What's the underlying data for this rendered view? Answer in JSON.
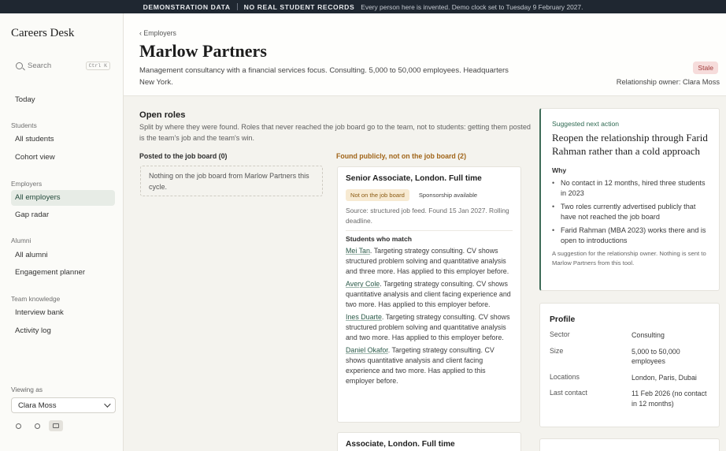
{
  "banner": {
    "tag1": "DEMONSTRATION DATA",
    "tag2": "NO REAL STUDENT RECORDS",
    "note": "Every person here is invented. Demo clock set to Tuesday 9 February 2027."
  },
  "sidebar": {
    "brand": "Careers Desk",
    "search": {
      "placeholder": "Search",
      "shortcut": "Ctrl K"
    },
    "today": "Today",
    "groups": {
      "students": "Students",
      "employers": "Employers",
      "alumni": "Alumni",
      "team": "Team knowledge"
    },
    "items": {
      "all_students": "All students",
      "cohort_view": "Cohort view",
      "all_employers": "All employers",
      "gap_radar": "Gap radar",
      "all_alumni": "All alumni",
      "engagement_planner": "Engagement planner",
      "interview_bank": "Interview bank",
      "activity_log": "Activity log"
    },
    "viewing_as_label": "Viewing as",
    "viewing_as_value": "Clara Moss"
  },
  "header": {
    "breadcrumb": "‹ Employers",
    "title": "Marlow Partners",
    "description": "Management consultancy with a financial services focus. Consulting. 5,000 to 50,000 employees. Headquarters New York.",
    "status": "Stale",
    "owner": "Relationship owner: Clara Moss"
  },
  "open_roles": {
    "title": "Open roles",
    "subtitle": "Split by where they were found. Roles that never reached the job board go to the team, not to students: getting them posted is the team's job and the team's win.",
    "posted_heading": "Posted to the job board (0)",
    "posted_empty": "Nothing on the job board from Marlow Partners this cycle.",
    "public_heading": "Found publicly, not on the job board (2)",
    "roles": [
      {
        "title": "Senior Associate, London. Full time",
        "tag_warn": "Not on the job board",
        "tag_plain": "Sponsorship available",
        "source": "Source: structured job feed. Found 15 Jan 2027. Rolling deadline.",
        "matches_heading": "Students who match",
        "matches": [
          {
            "name": "Mei Tan",
            "text": ". Targeting strategy consulting. CV shows structured problem solving and quantitative analysis and three more. Has applied to this employer before."
          },
          {
            "name": "Avery Cole",
            "text": ". Targeting strategy consulting. CV shows quantitative analysis and client facing experience and two more. Has applied to this employer before."
          },
          {
            "name": "Ines Duarte",
            "text": ". Targeting strategy consulting. CV shows structured problem solving and quantitative analysis and two more. Has applied to this employer before."
          },
          {
            "name": "Daniel Okafor",
            "text": ". Targeting strategy consulting. CV shows quantitative analysis and client facing experience and two more. Has applied to this employer before."
          }
        ]
      },
      {
        "title": "Associate, London. Full time"
      }
    ]
  },
  "suggestion": {
    "label": "Suggested next action",
    "headline": "Reopen the relationship through Farid Rahman rather than a cold approach",
    "why": "Why",
    "reasons": [
      "No contact in 12 months, hired three students in 2023",
      "Two roles currently advertised publicly that have not reached the job board",
      "Farid Rahman (MBA 2023) works there and is open to introductions"
    ],
    "footnote": "A suggestion for the relationship owner. Nothing is sent to Marlow Partners from this tool."
  },
  "profile": {
    "title": "Profile",
    "rows": [
      {
        "k": "Sector",
        "v": "Consulting"
      },
      {
        "k": "Size",
        "v": "5,000 to 50,000 employees"
      },
      {
        "k": "Locations",
        "v": "London, Paris, Dubai"
      },
      {
        "k": "Last contact",
        "v": "11 Feb 2026 (no contact in 12 months)"
      }
    ]
  }
}
